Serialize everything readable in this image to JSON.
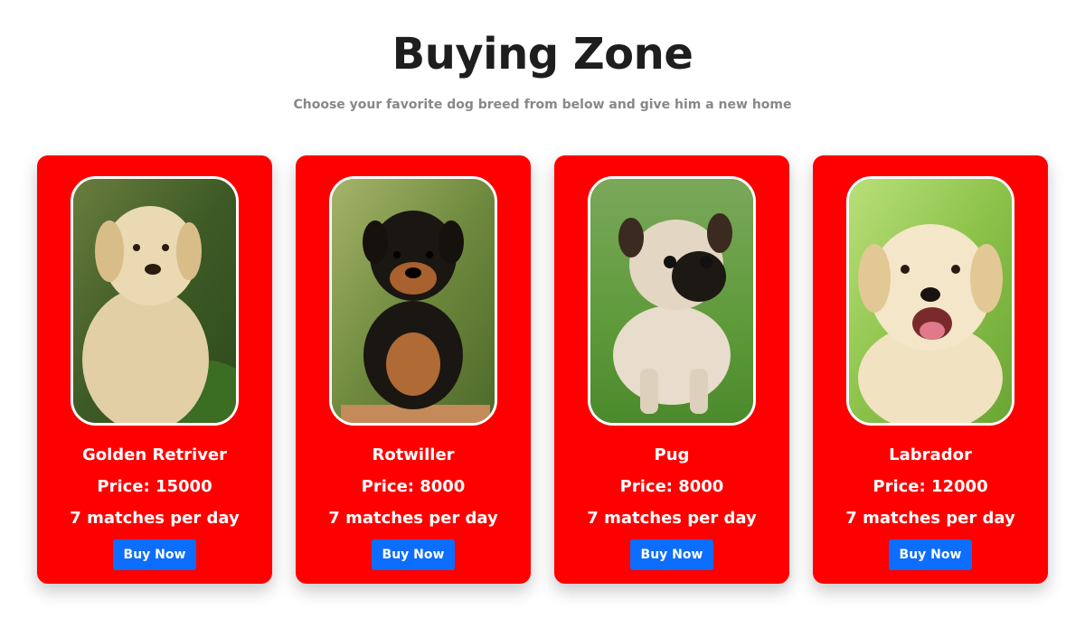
{
  "header": {
    "title": "Buying Zone",
    "subtitle": "Choose your favorite dog breed from below and give him a new home"
  },
  "colors": {
    "card_background": "#ff0000",
    "button": "#0d6efd",
    "title": "#1e1e1e",
    "subtitle": "#888888"
  },
  "cards": [
    {
      "name": "Golden Retriver",
      "price": "Price: 15000",
      "matches": "7 matches per day",
      "button": "Buy Now",
      "image": "golden-retriever-puppy-photo"
    },
    {
      "name": "Rotwiller",
      "price": "Price: 8000",
      "matches": "7 matches per day",
      "button": "Buy Now",
      "image": "rottweiler-puppy-photo"
    },
    {
      "name": "Pug",
      "price": "Price: 8000",
      "matches": "7 matches per day",
      "button": "Buy Now",
      "image": "pug-puppy-photo"
    },
    {
      "name": "Labrador",
      "price": "Price: 12000",
      "matches": "7 matches per day",
      "button": "Buy Now",
      "image": "labrador-puppy-photo"
    }
  ]
}
